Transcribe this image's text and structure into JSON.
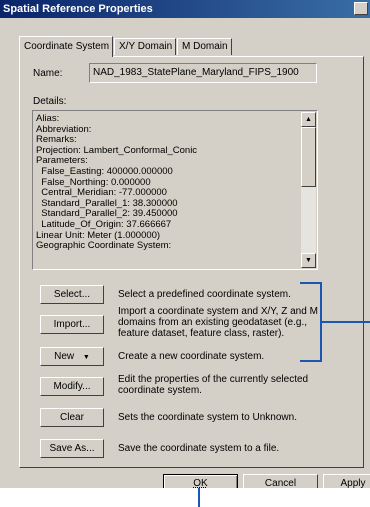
{
  "window": {
    "title": "Spatial Reference Properties"
  },
  "tabs": [
    {
      "label": "Coordinate System"
    },
    {
      "label": "X/Y Domain"
    },
    {
      "label": "M Domain"
    }
  ],
  "name_label": "Name:",
  "name_value": "NAD_1983_StatePlane_Maryland_FIPS_1900",
  "details_label": "Details:",
  "details_lines": [
    "Alias:",
    "Abbreviation:",
    "Remarks:",
    "Projection: Lambert_Conformal_Conic",
    "Parameters:",
    "  False_Easting: 400000.000000",
    "  False_Northing: 0.000000",
    "  Central_Meridian: -77.000000",
    "  Standard_Parallel_1: 38.300000",
    "  Standard_Parallel_2: 39.450000",
    "  Latitude_Of_Origin: 37.666667",
    "Linear Unit: Meter (1.000000)",
    "Geographic Coordinate System:"
  ],
  "actions": {
    "select": {
      "label": "Select...",
      "desc": [
        "Select a predefined coordinate system."
      ]
    },
    "import": {
      "label": "Import...",
      "desc": [
        "Import a coordinate system and X/Y, Z and M",
        "domains from an existing geodataset (e.g.,",
        "feature dataset, feature class, raster)."
      ]
    },
    "new": {
      "label": "New",
      "desc": [
        "Create a new coordinate system."
      ]
    },
    "modify": {
      "label": "Modify...",
      "desc": [
        "Edit the properties of the currently selected",
        "coordinate system."
      ]
    },
    "clear": {
      "label": "Clear",
      "desc": [
        "Sets the coordinate system to Unknown."
      ]
    },
    "save_as": {
      "label": "Save As...",
      "desc": [
        "Save the coordinate system to a file."
      ]
    }
  },
  "footer": {
    "ok": "OK",
    "cancel": "Cancel",
    "apply": "Apply"
  },
  "colors": {
    "title_bar": "#0a246a",
    "face": "#d4d0c8",
    "callout": "#1a56b4"
  },
  "icons": {
    "dropdown": "triangle-down",
    "scroll_up": "triangle-up",
    "scroll_down": "triangle-down"
  }
}
